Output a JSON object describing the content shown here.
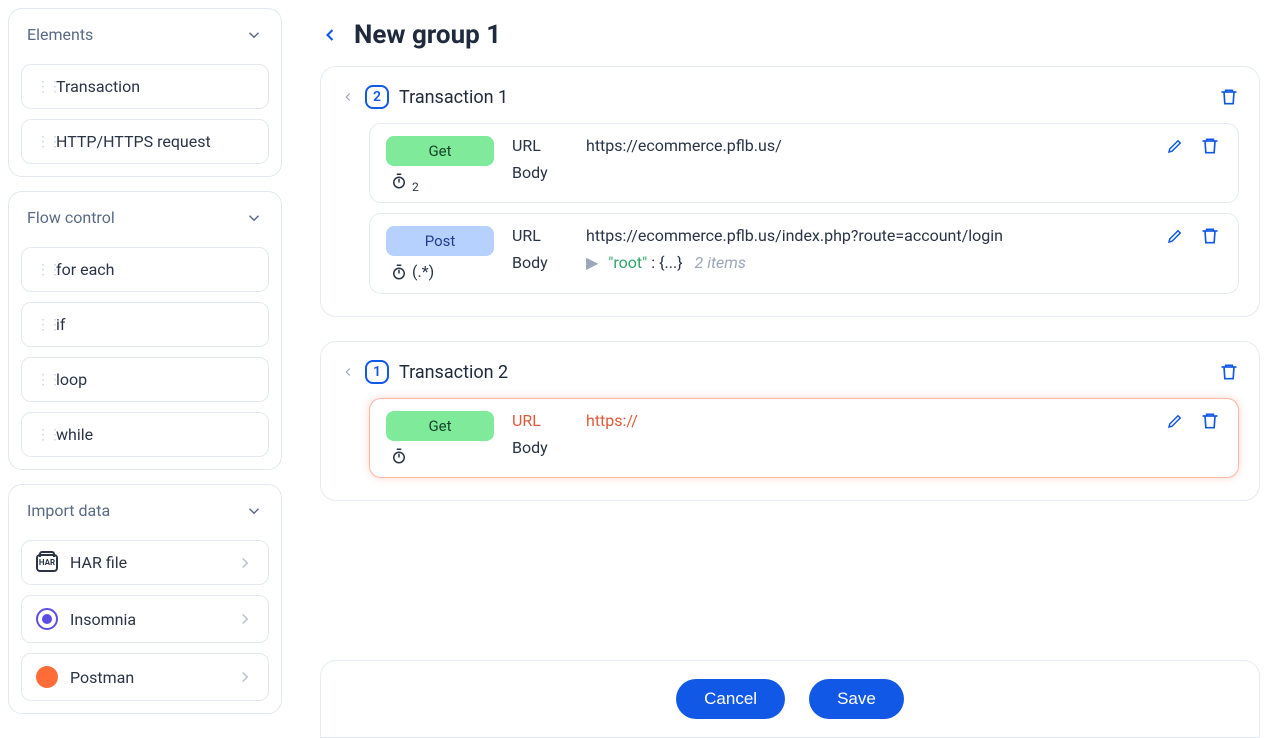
{
  "sidebar": {
    "sections": {
      "elements": {
        "title": "Elements",
        "items": [
          "Transaction",
          "HTTP/HTTPS request"
        ]
      },
      "flow": {
        "title": "Flow control",
        "items": [
          "for each",
          "if",
          "loop",
          "while"
        ]
      },
      "import": {
        "title": "Import data",
        "items": [
          "HAR file",
          "Insomnia",
          "Postman"
        ],
        "har_badge": "HAR"
      }
    }
  },
  "header": {
    "title": "New group 1"
  },
  "transactions": [
    {
      "count": "2",
      "title": "Transaction 1",
      "requests": [
        {
          "method": "Get",
          "method_class": "pill-get",
          "url_label": "URL",
          "url": "https://ecommerce.pflb.us/",
          "body_label": "Body",
          "body": "",
          "timer_sub": "2",
          "error": false
        },
        {
          "method": "Post",
          "method_class": "pill-post",
          "url_label": "URL",
          "url": "https://ecommerce.pflb.us/index.php?route=account/login",
          "body_label": "Body",
          "body_json": {
            "key": "\"root\"",
            "bracket": ": {...}",
            "items": "2 items"
          },
          "regex": "(.*)",
          "error": false
        }
      ]
    },
    {
      "count": "1",
      "title": "Transaction 2",
      "requests": [
        {
          "method": "Get",
          "method_class": "pill-get",
          "url_label": "URL",
          "url": "https://",
          "body_label": "Body",
          "body": "",
          "error": true
        }
      ]
    }
  ],
  "footer": {
    "cancel": "Cancel",
    "save": "Save"
  }
}
